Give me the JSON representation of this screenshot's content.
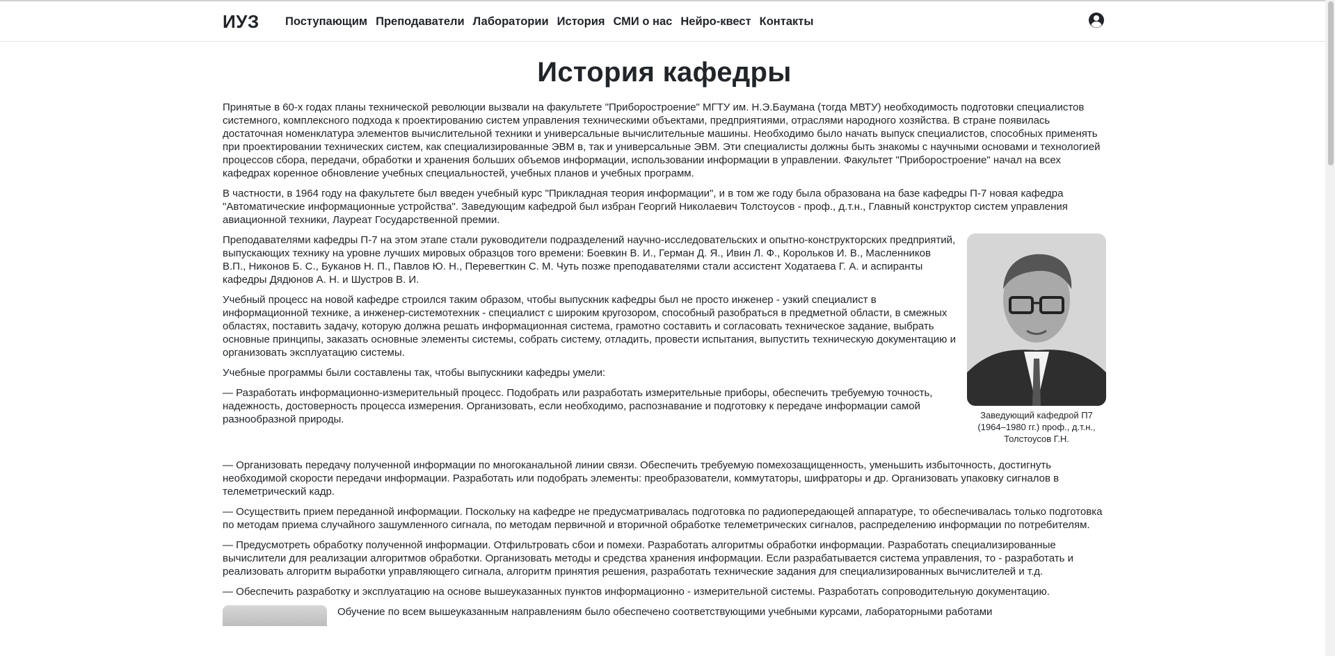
{
  "header": {
    "brand": "ИУЗ",
    "nav": [
      "Поступающим",
      "Преподаватели",
      "Лаборатории",
      "История",
      "СМИ о нас",
      "Нейро-квест",
      "Контакты"
    ],
    "user_icon": "user-circle-icon"
  },
  "page": {
    "title": "История кафедры",
    "paragraphs": [
      "Принятые в 60-х годах планы технической революции вызвали на факультете \"Приборостроение\" МГТУ им. Н.Э.Баумана (тогда МВТУ) необходимость подготовки специалистов системного, комплексного подхода к проектированию систем управления техническими объектами, предприятиями, отраслями народного хозяйства. В стране появилась достаточная номенклатура элементов вычислительной техники и универсальные вычислительные машины. Необходимо было начать выпуск специалистов, способных применять при проектировании технических систем, как специализированные ЭВМ в, так и универсальные ЭВМ. Эти специалисты должны быть знакомы с научными основами и технологией процессов сбора, передачи, обработки и хранения больших объемов информации, использовании информации в управлении. Факультет \"Приборостроение\" начал на всех кафедрах коренное обновление учебных специальностей, учебных планов и учебных программ.",
      "В частности, в 1964 году на факультете был введен учебный курс \"Прикладная теория информации\", и в том же году была образована на базе кафедры П-7 новая кафедра \"Автоматические информационные устройства\". Заведующим кафедрой был избран Георгий Николаевич Толстоусов - проф., д.т.н., Главный конструктор систем управления авиационной техники, Лауреат Государственной премии.",
      "Преподавателями кафедры П-7 на этом этапе стали руководители подразделений научно-исследовательских и опытно-конструкторских предприятий, выпускающих технику на уровне лучших мировых образцов того времени: Боевкин В. И., Герман Д. Я., Ивин Л. Ф., Корольков И. В., Масленников В.П., Никонов Б. С., Буканов Н. П., Павлов Ю. Н., Перевerткин С. М. Чуть позже преподавателями стали ассистент Ходатаева Г. А. и аспиранты кафедры Дядюнов А. Н. и Шустров В. И.",
      "Учебный процесс на новой кафедре строился таким образом, чтобы выпускник кафедры был не просто инженер - узкий специалист в информационной технике, а инженер-системотехник - специалист с широким кругозором, способный разобраться в предметной области, в смежных областях, поставить задачу, которую должна решать информационная система, грамотно составить и согласовать техническое задание, выбрать основные принципы, заказать основные элементы системы, собрать систему, отладить, провести испытания, выпустить техническую документацию и организовать эксплуатацию системы.",
      "Учебные программы были составлены так, чтобы выпускники кафедры умели:",
      "— Разработать информационно-измерительный процесс. Подобрать или разработать измерительные приборы, обеспечить требуемую точность, надежность, достоверность процесса измерения. Организовать, если необходимо, распознавание и подготовку к передаче информации самой разнообразной природы."
    ],
    "paragraphs_after": [
      "— Организовать передачу полученной информации по многоканальной линии связи. Обеспечить требуемую помехозащищенность, уменьшить избыточность, достигнуть необходимой скорости передачи информации. Разработать или подобрать элементы: преобразователи, коммутаторы, шифраторы и др. Организовать упаковку сигналов в телеметрический кадр.",
      "— Осуществить прием переданной информации. Поскольку на кафедре не предусматривалась подготовка по радиопередающей аппаратуре, то обеспечивалась только подготовка по методам приема случайного зашумленного сигнала, по методам первичной и вторичной обработке телеметрических сигналов, распределению информации по потребителям.",
      "— Предусмотреть обработку полученной информации. Отфильтровать сбои и помехи. Разработать алгоритмы обработки информации. Разработать специализированные вычислители для реализации алгоритмов обработки. Организовать методы и средства хранения информации. Если разрабатывается система управления, то - разработать и реализовать алгоритм выработки управляющего сигнала, алгоритм принятия решения, разработать технические задания для специализированных вычислителей и т.д.",
      "— Обеспечить разработку и эксплуатацию на основе вышеуказанных пунктов информационно - измерительной системы. Разработать сопроводительную документацию."
    ],
    "figure_caption": "Заведующий кафедрой П7 (1964–1980 гг.) проф., д.т.н., Толстоусов Г.Н.",
    "bottom_partial": "Обучение по всем вышеуказанным направлениям было обеспечено соответствующими учебными курсами, лабораторными работами"
  }
}
